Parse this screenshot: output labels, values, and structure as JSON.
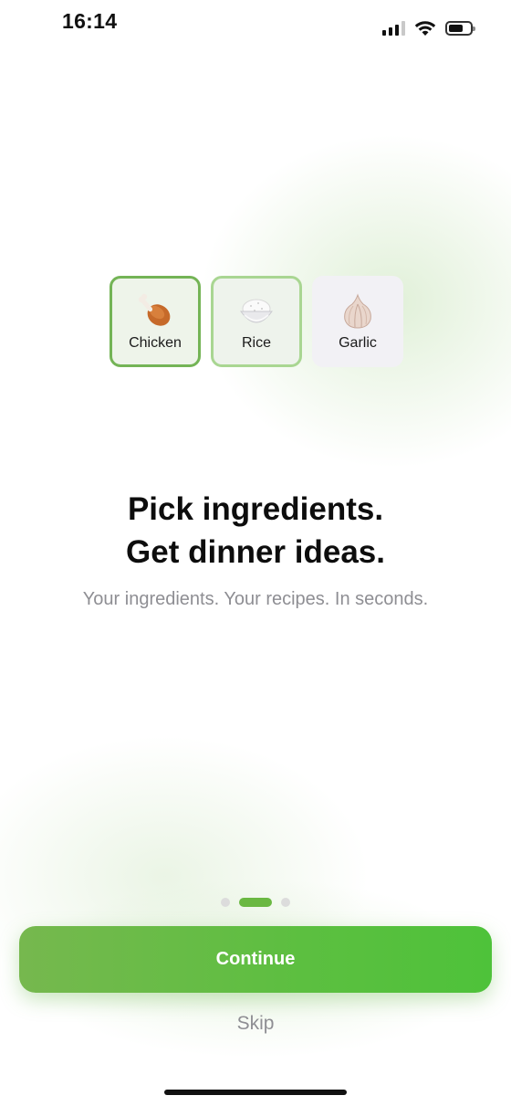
{
  "status_bar": {
    "time": "16:14",
    "icons": [
      "signal-icon",
      "wifi-icon",
      "battery-icon"
    ],
    "battery_level": 0.7
  },
  "ingredients": [
    {
      "label": "Chicken",
      "icon": "chicken-leg-icon",
      "state": "selected"
    },
    {
      "label": "Rice",
      "icon": "rice-bowl-icon",
      "state": "selected"
    },
    {
      "label": "Garlic",
      "icon": "garlic-icon",
      "state": "unselected"
    }
  ],
  "headline": {
    "line1": "Pick ingredients.",
    "line2": "Get dinner ideas."
  },
  "subheadline": "Your ingredients. Your recipes. In seconds.",
  "pagination": {
    "total": 3,
    "current": 2
  },
  "actions": {
    "continue_label": "Continue",
    "skip_label": "Skip"
  },
  "colors": {
    "accent": "#5cbf40",
    "selected_border": "#74b456",
    "secondary_border": "#a9d692",
    "muted_text": "#8e8e93"
  }
}
